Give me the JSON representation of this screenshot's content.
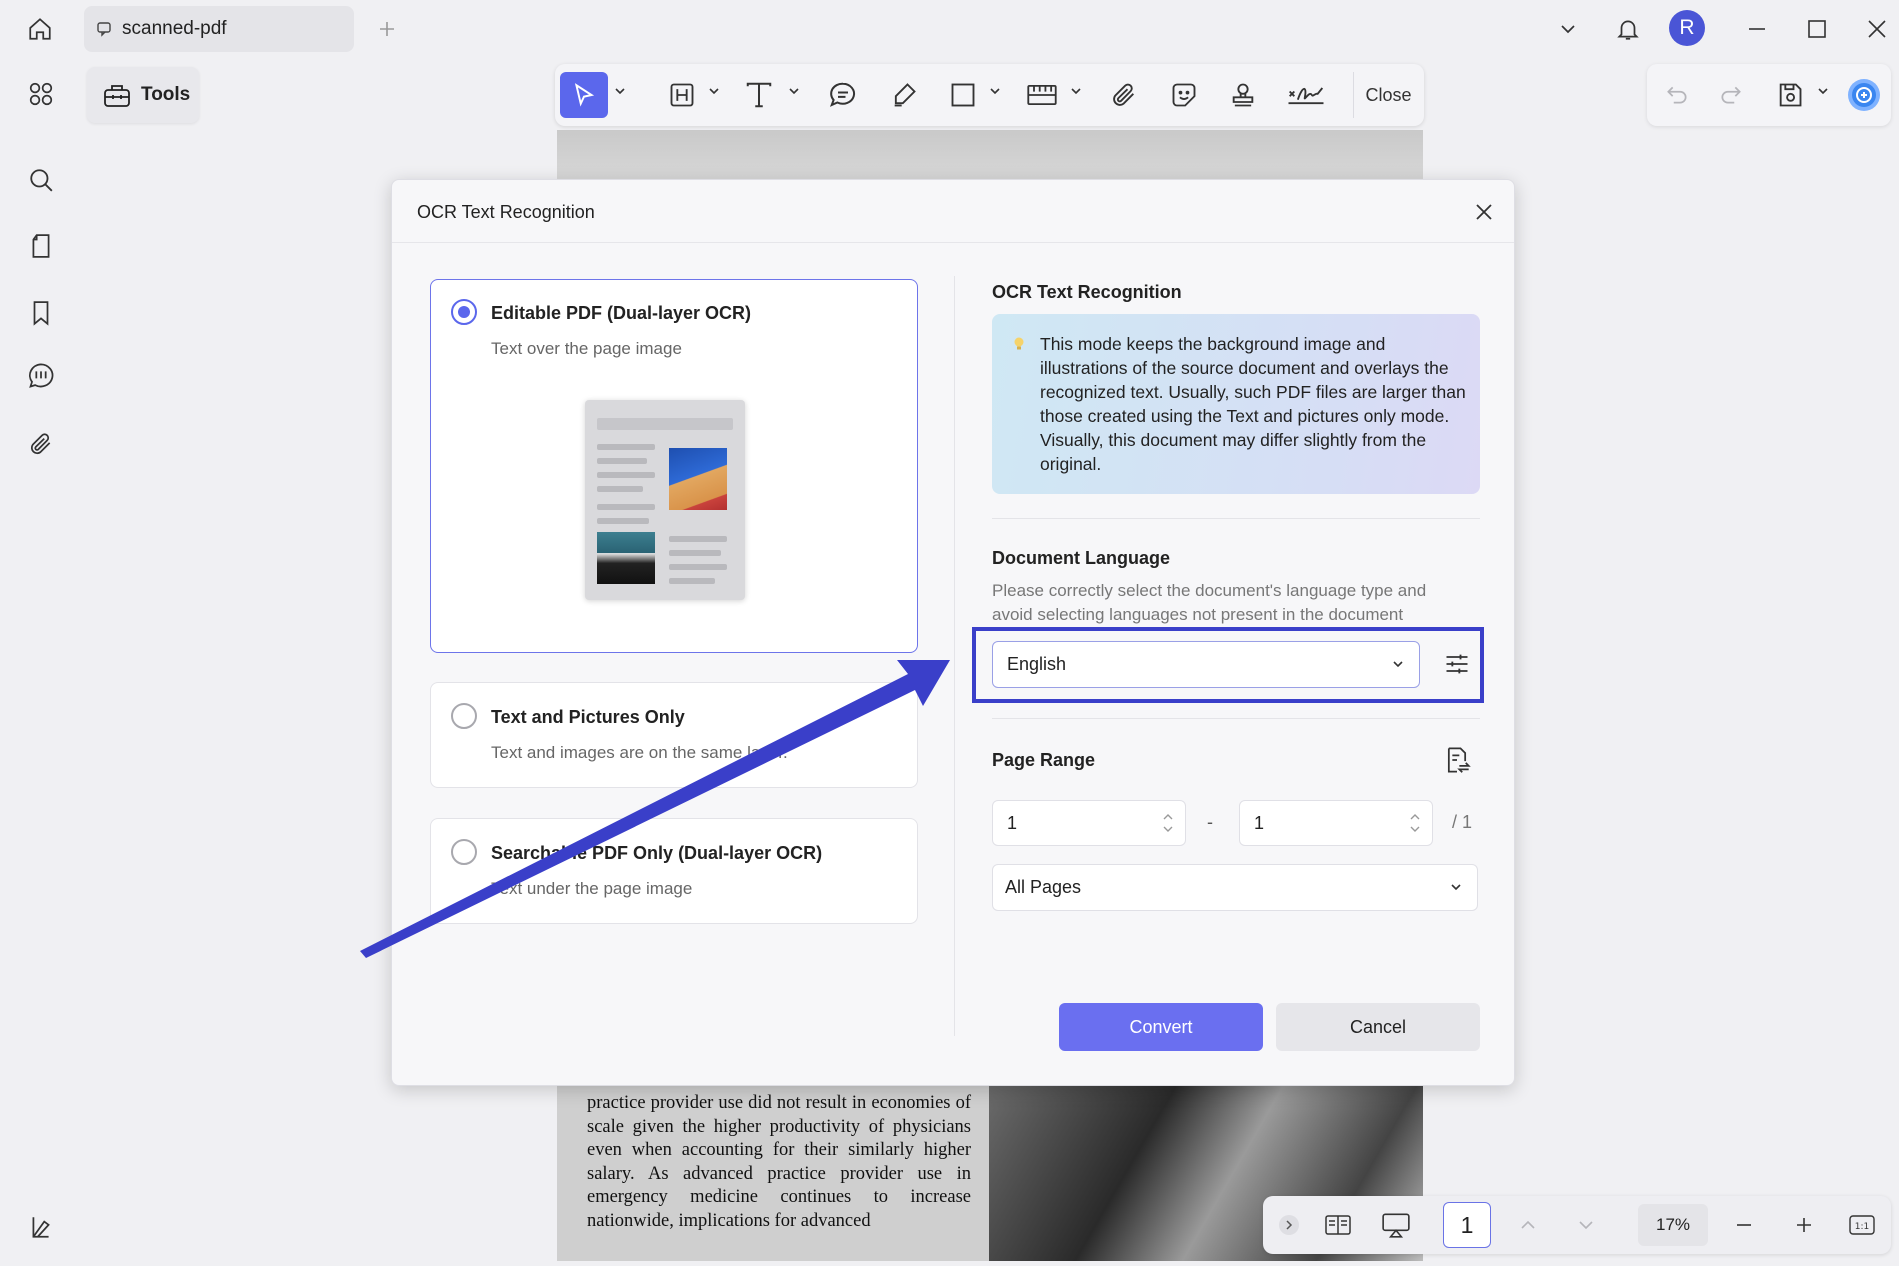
{
  "window": {
    "tab_title": "scanned-pdf",
    "avatar_initial": "R"
  },
  "tools": {
    "label": "Tools"
  },
  "toolbar": {
    "close_label": "Close"
  },
  "dialog": {
    "title": "OCR Text Recognition",
    "options": [
      {
        "title": "Editable PDF (Dual-layer OCR)",
        "subtitle": "Text over the page image",
        "selected": true
      },
      {
        "title": "Text and Pictures Only",
        "subtitle": "Text and images are on the same layer.",
        "selected": false
      },
      {
        "title": "Searchable PDF Only (Dual-layer OCR)",
        "subtitle": "Text under the page image",
        "selected": false
      }
    ],
    "ocr_section_title": "OCR Text Recognition",
    "ocr_info": "This mode keeps the background image and illustrations of the source document and overlays the recognized text. Usually, such PDF files are larger than those created using the Text and pictures only mode. Visually, this document may differ slightly from the original.",
    "language_title": "Document Language",
    "language_desc": "Please correctly select the document's language type and avoid selecting languages not present in the document",
    "language_value": "English",
    "page_range_title": "Page Range",
    "range_from": "1",
    "range_separator": "-",
    "range_to": "1",
    "range_total": "/ 1",
    "pages_option": "All Pages",
    "convert_label": "Convert",
    "cancel_label": "Cancel"
  },
  "document": {
    "visible_text": "practice provider use did not result in economies of scale given the higher productivity of physicians even when accounting for their similarly higher salary. As advanced practice provider use in emergency medicine continues to increase nationwide, implications for advanced"
  },
  "statusbar": {
    "page_number": "1",
    "zoom": "17%"
  },
  "colors": {
    "accent": "#5b67ec",
    "highlight": "#3a3fc9"
  }
}
